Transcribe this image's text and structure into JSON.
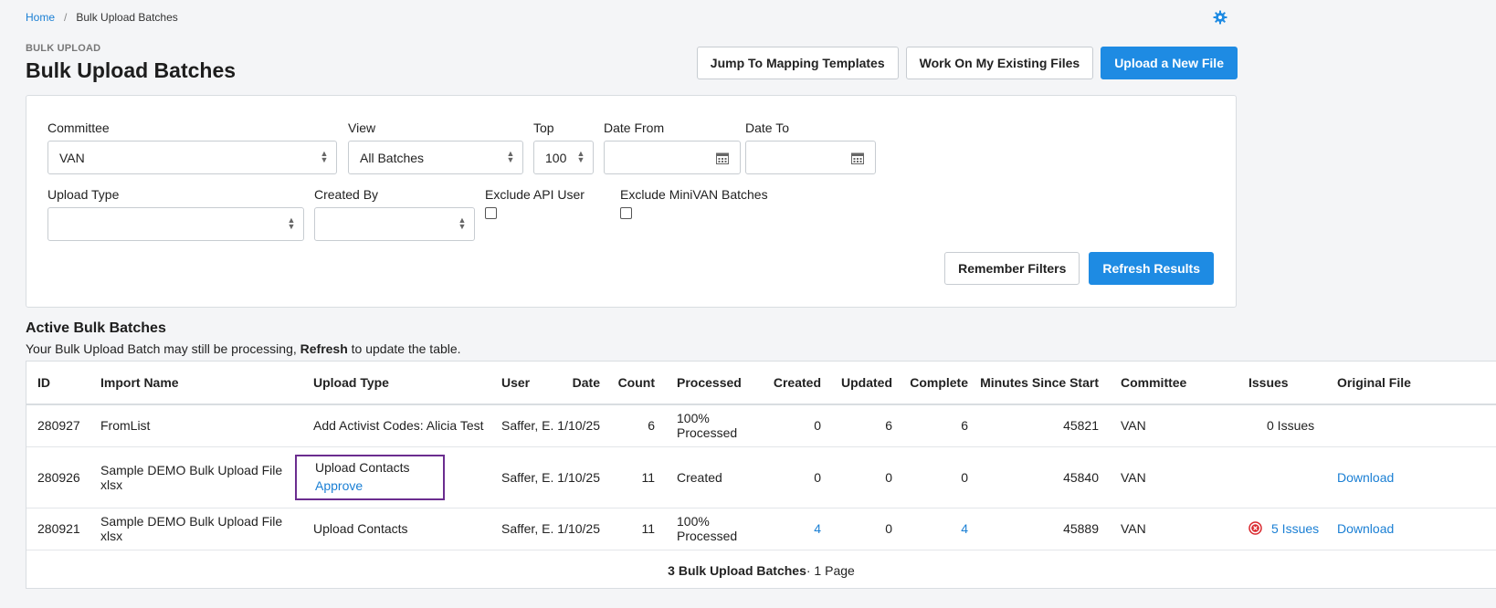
{
  "breadcrumb": {
    "home": "Home",
    "separator": "/",
    "current": "Bulk Upload Batches"
  },
  "header": {
    "eyebrow": "BULK UPLOAD",
    "title": "Bulk Upload Batches",
    "buttons": {
      "mapping": "Jump To Mapping Templates",
      "existing": "Work On My Existing Files",
      "upload": "Upload a New File"
    }
  },
  "filters": {
    "committee": {
      "label": "Committee",
      "value": "VAN"
    },
    "view": {
      "label": "View",
      "value": "All Batches"
    },
    "top": {
      "label": "Top",
      "value": "100"
    },
    "date_from": {
      "label": "Date From",
      "value": ""
    },
    "date_to": {
      "label": "Date To",
      "value": ""
    },
    "upload_type": {
      "label": "Upload Type",
      "value": ""
    },
    "created_by": {
      "label": "Created By",
      "value": ""
    },
    "exclude_api": {
      "label": "Exclude API User",
      "checked": false
    },
    "exclude_minivan": {
      "label": "Exclude MiniVAN Batches",
      "checked": false
    },
    "remember": "Remember Filters",
    "refresh": "Refresh Results"
  },
  "section": {
    "title": "Active Bulk Batches",
    "note_prefix": "Your Bulk Upload Batch may still be processing, ",
    "note_bold": "Refresh",
    "note_suffix": " to update the table."
  },
  "table": {
    "headers": {
      "id": "ID",
      "import_name": "Import Name",
      "upload_type": "Upload Type",
      "user": "User",
      "date": "Date",
      "count": "Count",
      "processed": "Processed",
      "created": "Created",
      "updated": "Updated",
      "complete": "Complete",
      "minutes": "Minutes Since Start",
      "committee": "Committee",
      "issues": "Issues",
      "original_file": "Original File"
    },
    "rows": [
      {
        "id": "280927",
        "import_name": "FromList",
        "upload_type": "Add Activist Codes: Alicia Test",
        "user": "Saffer, E.",
        "date": "1/10/25",
        "count": "6",
        "processed": "100% Processed",
        "created": "0",
        "updated": "6",
        "complete": "6",
        "minutes": "45821",
        "committee": "VAN",
        "issues": "0 Issues",
        "original_file": ""
      },
      {
        "id": "280926",
        "import_name": "Sample DEMO Bulk Upload File xlsx",
        "upload_type": "Upload Contacts",
        "upload_action": "Approve",
        "user": "Saffer, E.",
        "date": "1/10/25",
        "count": "11",
        "processed": "Created",
        "created": "0",
        "updated": "0",
        "complete": "0",
        "minutes": "45840",
        "committee": "VAN",
        "issues": "",
        "original_file": "Download"
      },
      {
        "id": "280921",
        "import_name": "Sample DEMO Bulk Upload File xlsx",
        "upload_type": "Upload Contacts",
        "user": "Saffer, E.",
        "date": "1/10/25",
        "count": "11",
        "processed": "100% Processed",
        "created": "4",
        "updated": "0",
        "complete": "4",
        "minutes": "45889",
        "committee": "VAN",
        "issues": "5 Issues",
        "original_file": "Download"
      }
    ],
    "footer_bold": "3 Bulk Upload Batches",
    "footer_rest": " · 1 Page"
  },
  "colors": {
    "accent": "#1e8be3",
    "highlight": "#6b2d8f",
    "error": "#d9262c"
  }
}
